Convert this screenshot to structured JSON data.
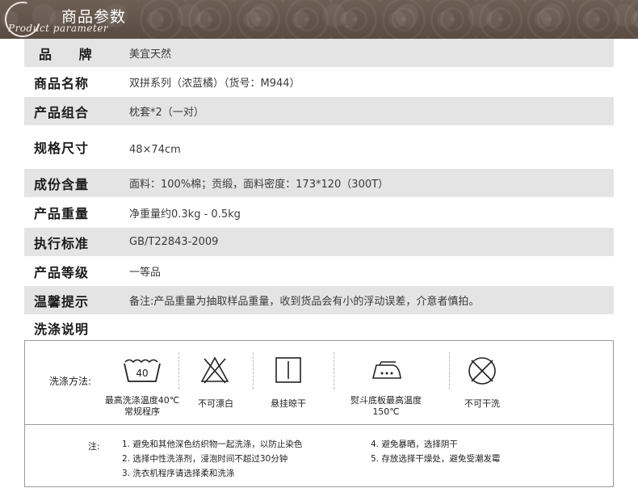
{
  "header": {
    "title": "商品参数",
    "subtitle": "Product parameter"
  },
  "params": [
    {
      "label": "品 牌",
      "value": "美宜天然"
    },
    {
      "label": "商品名称",
      "value": "双拼系列（浓蓝橘）（货号：M944）"
    },
    {
      "label": "产品组合",
      "value": "枕套*2（一对）"
    },
    {
      "label": "规格尺寸",
      "value": "48×74cm"
    },
    {
      "label": "成份含量",
      "value": "面料：100%棉；贡缎，面料密度：173*120（300T）"
    },
    {
      "label": "产品重量",
      "value": "净重量约0.3kg - 0.5kg"
    },
    {
      "label": "执行标准",
      "value": "GB/T22843-2009"
    },
    {
      "label": "产品等级",
      "value": "一等品"
    },
    {
      "label": "温馨提示",
      "value": "备注:产品重量为抽取样品重量，收到货品会有小的浮动误差，介意者慎拍。"
    },
    {
      "label": "洗涤说明",
      "value": ""
    }
  ],
  "washing": {
    "method_label": "洗涤方法:",
    "symbols": [
      {
        "icon": "wash-40-icon",
        "number": "40",
        "caption_line1": "最高洗涤温度40℃",
        "caption_line2": "常规程序"
      },
      {
        "icon": "no-bleach-icon",
        "caption_line1": "不可漂白"
      },
      {
        "icon": "hang-dry-icon",
        "caption_line1": "悬挂晾干"
      },
      {
        "icon": "iron-icon",
        "caption_line1": "熨斗底板最高温度",
        "caption_line2": "150℃"
      },
      {
        "icon": "no-dry-clean-icon",
        "caption_line1": "不可干洗"
      }
    ],
    "notes_label": "注:",
    "notes": [
      "1. 避免和其他深色纺织物一起洗涤，以防止染色",
      "2. 选择中性洗涤剂，浸泡时间不超过30分钟",
      "3. 洗衣机程序请选择柔和洗涤",
      "4. 避免暴晒，选择阴干",
      "5. 存放选择干燥处，避免受潮发霉"
    ]
  },
  "colors": {
    "banner": "#5f5047",
    "row_gray": "#e4e4e4",
    "border": "#9a9a9a"
  }
}
